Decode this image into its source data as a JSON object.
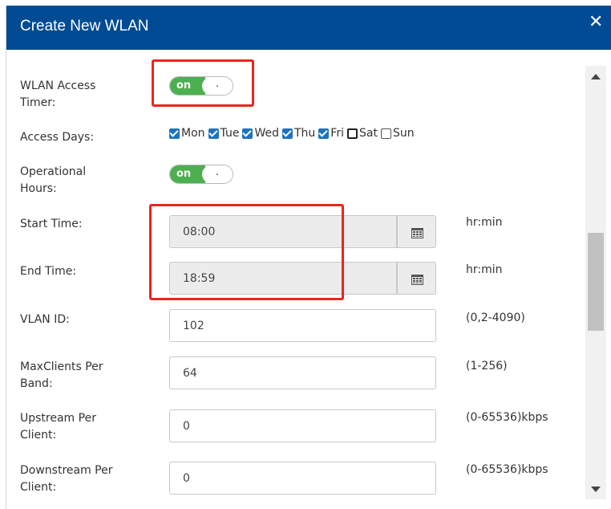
{
  "dialog": {
    "title": "Create New WLAN",
    "close_glyph": "✕",
    "header_color": "#004b93"
  },
  "form": {
    "wlan_access_timer": {
      "label_line1": "WLAN Access",
      "label_line2": "Timer:",
      "toggle_on": "on",
      "toggle_knob": ".",
      "state": "on"
    },
    "access_days": {
      "label": "Access Days:",
      "days": [
        {
          "name": "Mon",
          "checked": true
        },
        {
          "name": "Tue",
          "checked": true
        },
        {
          "name": "Wed",
          "checked": true
        },
        {
          "name": "Thu",
          "checked": true
        },
        {
          "name": "Fri",
          "checked": true
        },
        {
          "name": "Sat",
          "checked": false
        },
        {
          "name": "Sun",
          "checked": false
        }
      ]
    },
    "operational_hours": {
      "label_line1": "Operational",
      "label_line2": "Hours:",
      "toggle_on": "on",
      "toggle_knob": ".",
      "state": "on"
    },
    "start_time": {
      "label": "Start Time:",
      "value": "08:00",
      "unit": "hr:min",
      "icon": "calendar-icon"
    },
    "end_time": {
      "label": "End Time:",
      "value": "18:59",
      "unit": "hr:min",
      "icon": "calendar-icon"
    },
    "vlan_id": {
      "label": "VLAN ID:",
      "value": "102",
      "hint": "(0,2-4090)"
    },
    "max_clients": {
      "label_line1": "MaxClients Per",
      "label_line2": "Band:",
      "value": "64",
      "hint": "(1-256)"
    },
    "upstream": {
      "label_line1": "Upstream Per",
      "label_line2": "Client:",
      "value": "0",
      "hint": "(0-65536)kbps"
    },
    "downstream": {
      "label_line1": "Downstream Per",
      "label_line2": "Client:",
      "value": "0",
      "hint": "(0-65536)kbps"
    }
  },
  "colors": {
    "toggle_on": "#4caf50",
    "highlight": "#e8261e",
    "checkbox": "#1e73be"
  }
}
